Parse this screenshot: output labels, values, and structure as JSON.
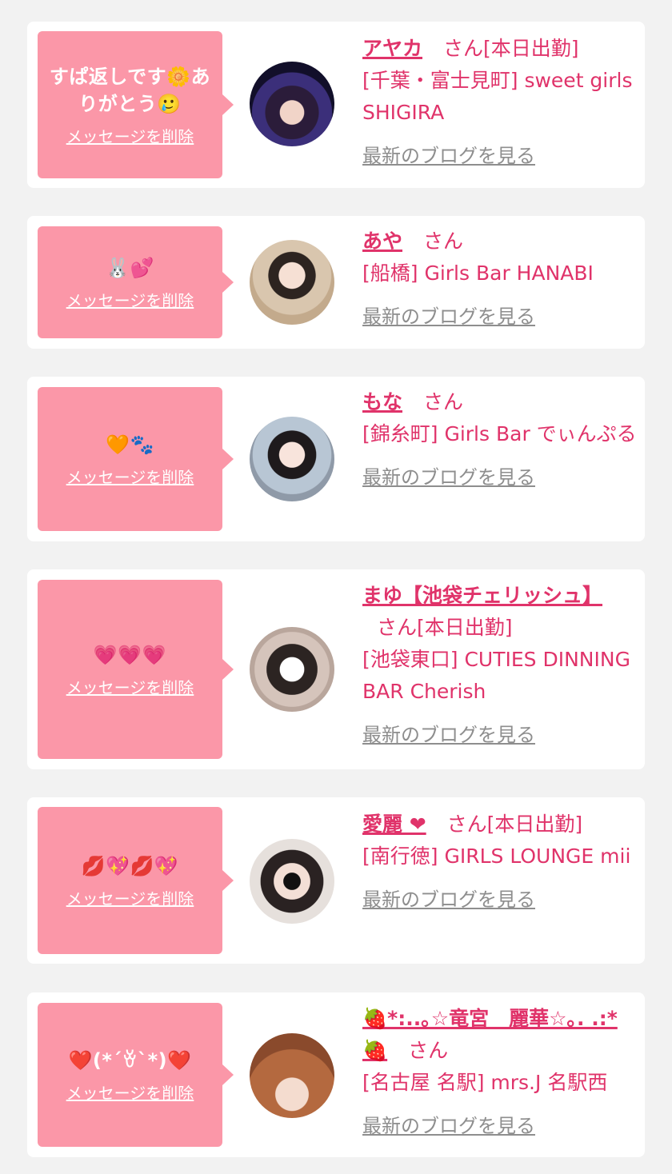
{
  "delete_label": "メッセージを削除",
  "blog_label": "最新のブログを見る",
  "san_label": "さん",
  "cards": [
    {
      "message": "すぱ返しです🌼ありがとう🥲",
      "name": "アヤカ",
      "status": "[本日出勤]",
      "shop": "[千葉・富士見町] sweet girls SHIGIRA"
    },
    {
      "message": "🐰💕",
      "name": "あや",
      "status": "",
      "shop": "[船橋] Girls Bar HANABI"
    },
    {
      "message": "🧡🐾",
      "name": "もな",
      "status": "",
      "shop": "[錦糸町] Girls Bar でぃんぷる"
    },
    {
      "message": "💗💗💗",
      "name": "まゆ【池袋チェリッシュ】",
      "status": "[本日出勤]",
      "shop": "[池袋東口] CUTIES DINNING BAR Cherish"
    },
    {
      "message": "💋💖💋💖",
      "name": "愛麗 ❤",
      "status": "[本日出勤]",
      "shop": "[南行徳] GIRLS LOUNGE mii"
    },
    {
      "message": "❤️(*´ꈊ`*)❤️",
      "name": "🍓*:..｡☆竜宮　麗華☆｡. .:*🍓",
      "status": "",
      "shop": "[名古屋 名駅] mrs.J 名駅西"
    }
  ],
  "colors": {
    "background": "#f2f2f2",
    "card": "#ffffff",
    "bubble": "#fb97a8",
    "accent": "#e0336a",
    "link_gray": "#8e8e8e"
  }
}
